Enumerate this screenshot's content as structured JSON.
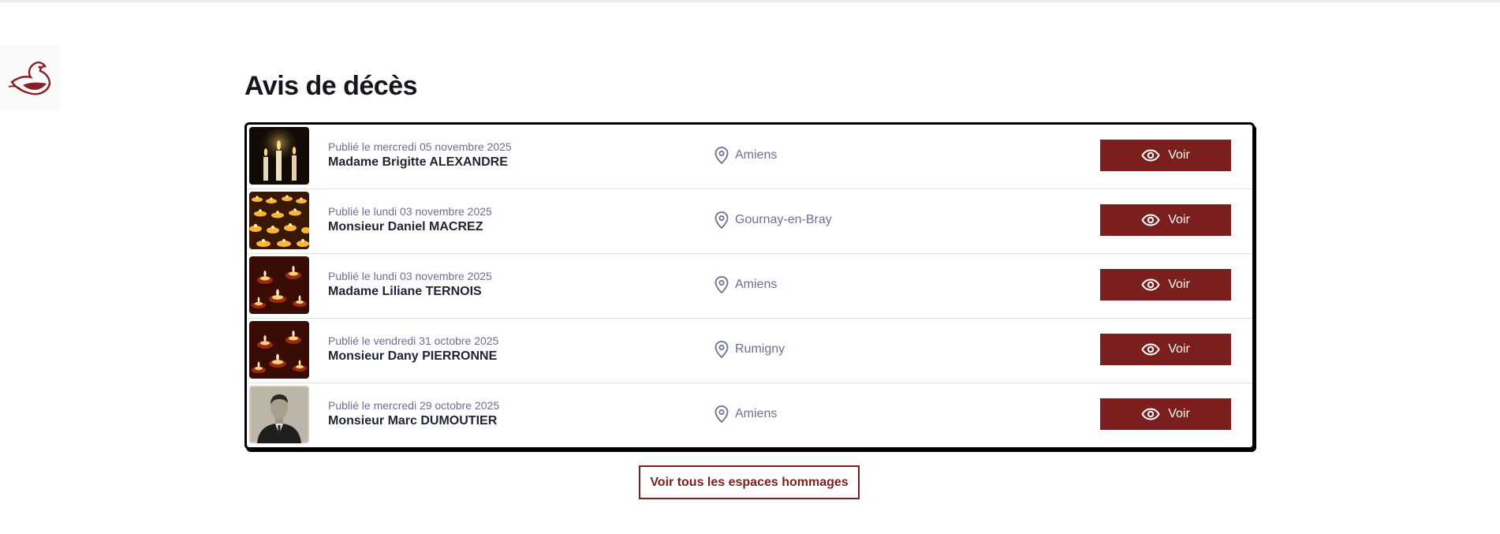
{
  "title": "Avis de décès",
  "items": [
    {
      "date": "Publié le mercredi 05 novembre 2025",
      "name": "Madame Brigitte ALEXANDRE",
      "location": "Amiens",
      "button": "Voir",
      "thumb": "candles-dark-icon"
    },
    {
      "date": "Publié le lundi 03 novembre 2025",
      "name": "Monsieur Daniel MACREZ",
      "location": "Gournay-en-Bray",
      "button": "Voir",
      "thumb": "tealights-icon"
    },
    {
      "date": "Publié le lundi 03 novembre 2025",
      "name": "Madame Liliane TERNOIS",
      "location": "Amiens",
      "button": "Voir",
      "thumb": "tealights-red-icon"
    },
    {
      "date": "Publié le vendredi 31 octobre 2025",
      "name": "Monsieur Dany PIERRONNE",
      "location": "Rumigny",
      "button": "Voir",
      "thumb": "tealights-red-icon"
    },
    {
      "date": "Publié le mercredi 29 octobre 2025",
      "name": "Monsieur Marc DUMOUTIER",
      "location": "Amiens",
      "button": "Voir",
      "thumb": "portrait-photo-icon"
    }
  ],
  "all_button": "Voir tous les espaces hommages",
  "colors": {
    "accent": "#7a1f1d",
    "muted": "#6b7090",
    "text": "#1f2433"
  }
}
